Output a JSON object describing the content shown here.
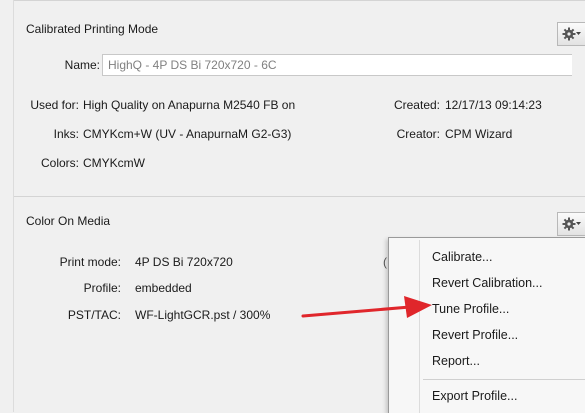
{
  "calibrated_mode": {
    "title": "Calibrated Printing Mode",
    "name_label": "Name:",
    "name_value": "HighQ - 4P DS Bi 720x720 - 6C",
    "used_for_label": "Used for:",
    "used_for_value": "High Quality on Anapurna M2540 FB on",
    "inks_label": "Inks:",
    "inks_value": "CMYKcm+W (UV - AnapurnaM G2-G3)",
    "colors_label": "Colors:",
    "colors_value": "CMYKcmW",
    "created_label": "Created:",
    "created_value": "12/17/13 09:14:23",
    "creator_label": "Creator:",
    "creator_value": "CPM Wizard"
  },
  "color_on_media": {
    "title": "Color On Media",
    "print_mode_label": "Print mode:",
    "print_mode_value": "4P DS Bi 720x720",
    "profile_label": "Profile:",
    "profile_value": "embedded",
    "pst_tac_label": "PST/TAC:",
    "pst_tac_value": "WF-LightGCR.pst /  300%",
    "clipped_text": "("
  },
  "context_menu": {
    "calibrate": "Calibrate...",
    "revert_calibration": "Revert Calibration...",
    "tune_profile": "Tune Profile...",
    "revert_profile": "Revert Profile...",
    "report": "Report...",
    "export_profile": "Export Profile..."
  },
  "icons": {
    "gear": "gear-icon",
    "annotation_arrow": "arrow-right-icon"
  },
  "colors": {
    "arrow": "#e0262b",
    "background": "#f0f0f0",
    "menu_background": "#f7f7f7"
  }
}
